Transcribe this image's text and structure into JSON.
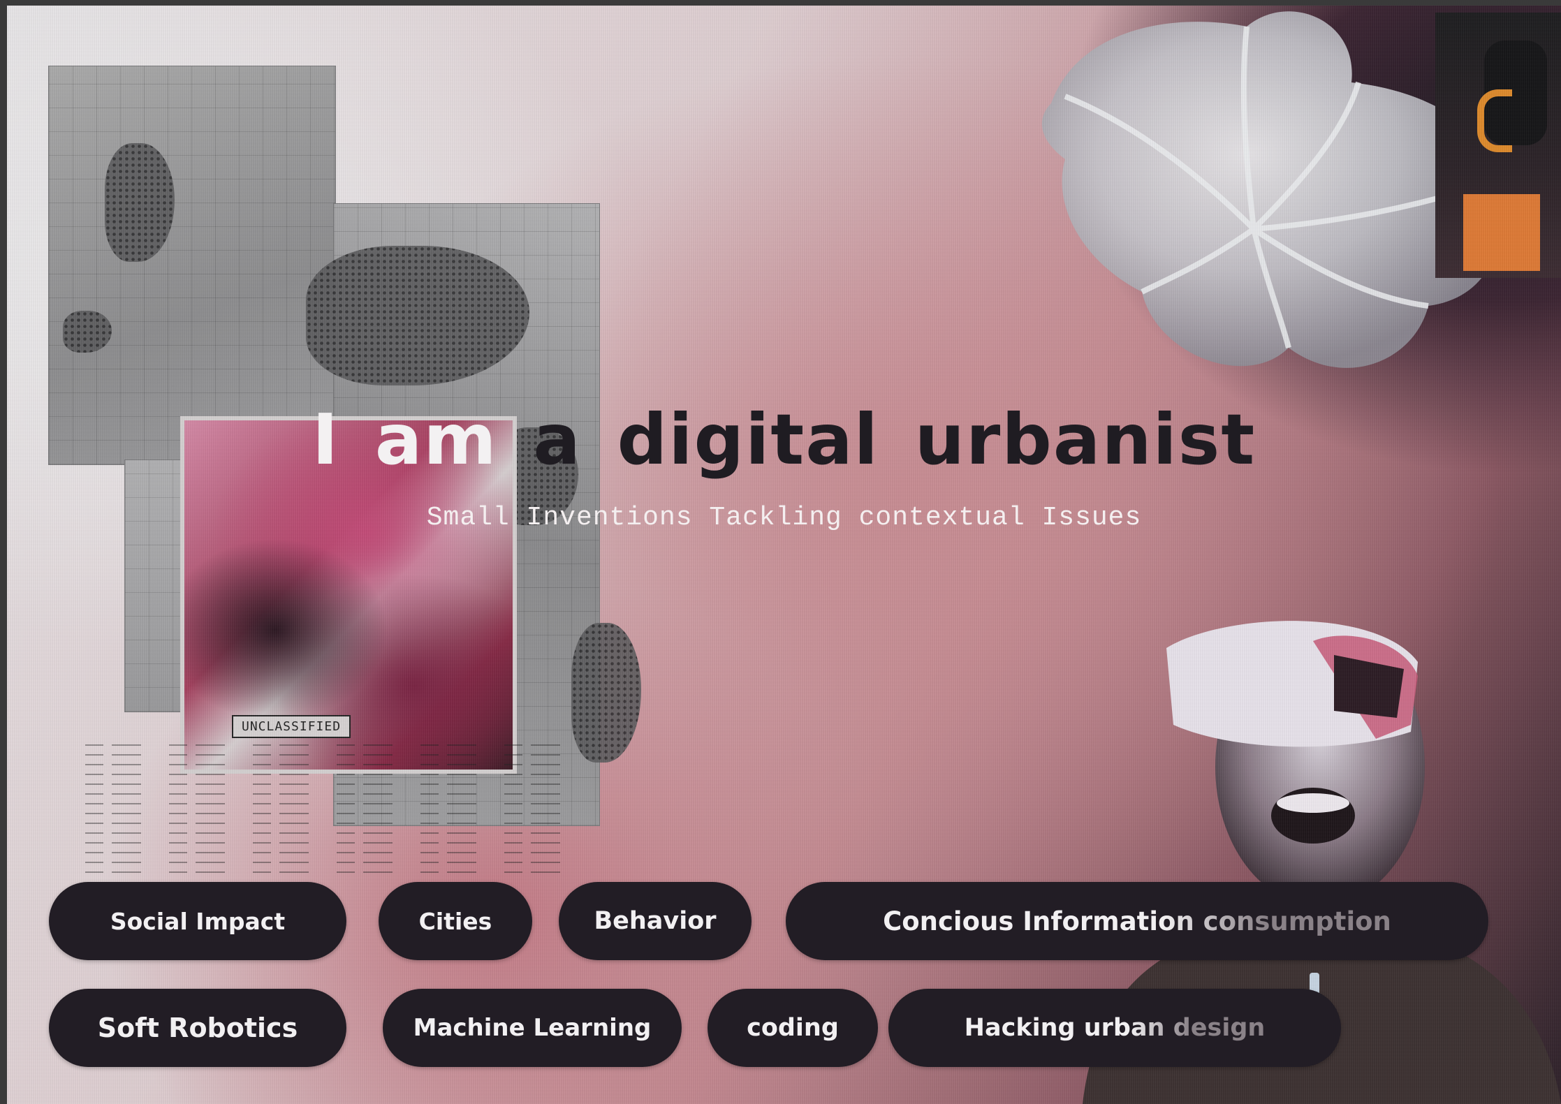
{
  "headline": {
    "light_part": "I am",
    "dark_part": "a digital urbanist"
  },
  "subtitle": "Small Inventions Tackling contextual Issues",
  "map_stamp": "UNCLASSIFIED",
  "tags_row1": [
    {
      "label": "Social Impact"
    },
    {
      "label": "Cities"
    },
    {
      "label": "Behavior"
    },
    {
      "label": "Concious Information consumption"
    }
  ],
  "tags_row2": [
    {
      "label": "Soft Robotics"
    },
    {
      "label": "Machine Learning"
    },
    {
      "label": "coding"
    },
    {
      "label": "Hacking urban design"
    }
  ],
  "colors": {
    "pill_background": "#221d25",
    "pill_text": "#f2f0f2",
    "headline_dark": "#1f1c22",
    "accent_pink": "#c48c93",
    "accent_orange": "#e07a34"
  }
}
